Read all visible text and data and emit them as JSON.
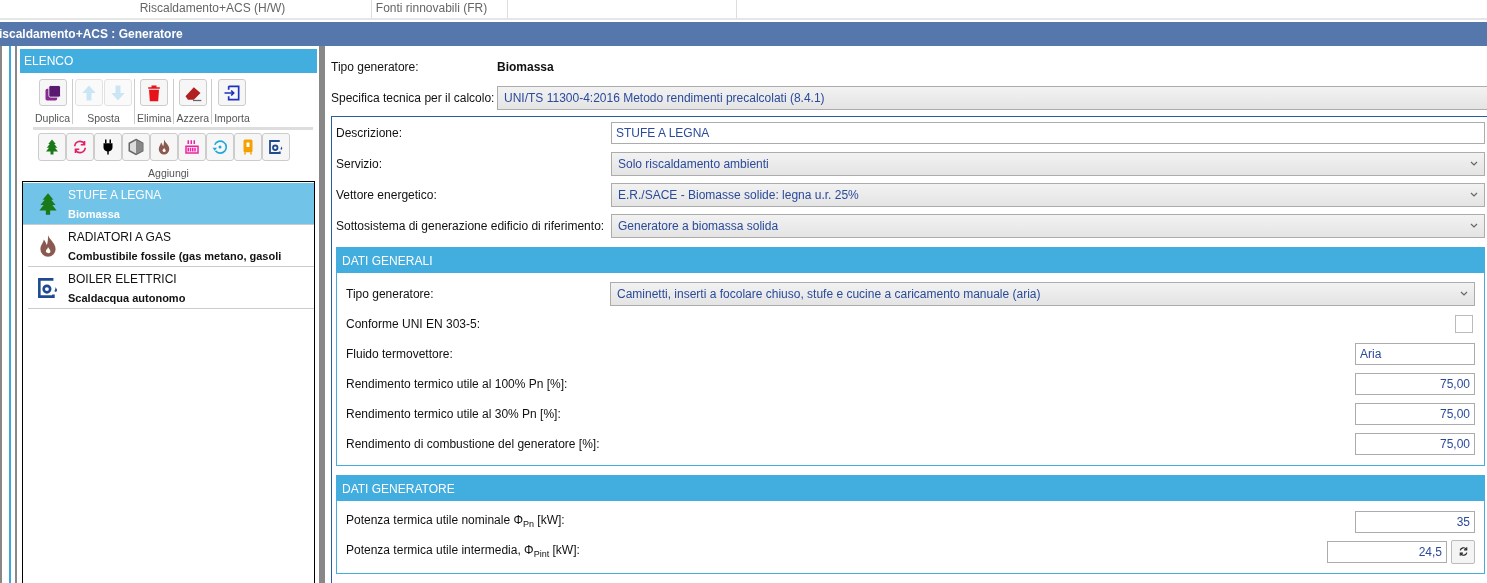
{
  "top_tabs": [
    {
      "label": "Riscaldamento+ACS (H/W)"
    },
    {
      "label": "Fonti rinnovabili (FR)"
    }
  ],
  "title_bar": "iscaldamento+ACS : Generatore",
  "elenco": {
    "title": "ELENCO",
    "toolbar_groups": [
      {
        "label": "Duplica",
        "buttons": [
          {
            "kind": "duplicate",
            "disabled": false
          }
        ]
      },
      {
        "label": "Sposta",
        "buttons": [
          {
            "kind": "up",
            "disabled": true
          },
          {
            "kind": "down",
            "disabled": true
          }
        ]
      },
      {
        "label": "Elimina",
        "buttons": [
          {
            "kind": "trash",
            "disabled": false
          }
        ]
      },
      {
        "label": "Azzera",
        "buttons": [
          {
            "kind": "eraser",
            "disabled": false
          }
        ]
      },
      {
        "label": "Importa",
        "buttons": [
          {
            "kind": "import",
            "disabled": false
          }
        ]
      }
    ],
    "add_buttons": [
      {
        "kind": "tree"
      },
      {
        "kind": "cycle"
      },
      {
        "kind": "plug"
      },
      {
        "kind": "hexagon"
      },
      {
        "kind": "flame"
      },
      {
        "kind": "radiator"
      },
      {
        "kind": "rotate"
      },
      {
        "kind": "boiler"
      },
      {
        "kind": "heater"
      }
    ],
    "add_label": "Aggiungi",
    "items": [
      {
        "kind": "tree",
        "title": "STUFE A LEGNA",
        "subtitle": "Biomassa",
        "selected": true
      },
      {
        "kind": "flame",
        "title": "RADIATORI A GAS",
        "subtitle": "Combustibile fossile (gas metano, gasoli",
        "selected": false
      },
      {
        "kind": "heater",
        "title": "BOILER ELETTRICI",
        "subtitle": "Scaldacqua autonomo",
        "selected": false
      }
    ]
  },
  "header_fields": [
    {
      "kind": "static",
      "label": "Tipo generatore:",
      "value": "Biomassa"
    },
    {
      "kind": "readonly",
      "label": "Specifica tecnica per il calcolo:",
      "value": "UNI/TS 11300-4:2016 Metodo rendimenti precalcolati (8.4.1)"
    }
  ],
  "main_fields": [
    {
      "kind": "text",
      "label": "Descrizione:",
      "value": "STUFE A LEGNA"
    },
    {
      "kind": "select",
      "label": "Servizio:",
      "value": "Solo riscaldamento ambienti"
    },
    {
      "kind": "select",
      "label": "Vettore energetico:",
      "value": "E.R./SACE - Biomasse solide: legna u.r. 25%"
    },
    {
      "kind": "select",
      "label": "Sottosistema di generazione edificio di riferimento:",
      "value": "Generatore a biomassa solida"
    }
  ],
  "sections": [
    {
      "title": "DATI GENERALI",
      "fields": [
        {
          "kind": "select",
          "label": "Tipo generatore:",
          "value": "Caminetti, inserti a focolare chiuso, stufe e cucine a caricamento manuale (aria)"
        },
        {
          "kind": "checkbox",
          "label": "Conforme UNI EN 303-5:",
          "checked": false
        },
        {
          "kind": "short",
          "label": "Fluido termovettore:",
          "value": "Aria"
        },
        {
          "kind": "number",
          "label": "Rendimento termico utile al 100% Pn [%]:",
          "value": "75,00"
        },
        {
          "kind": "number",
          "label": "Rendimento termico utile al 30% Pn [%]:",
          "value": "75,00"
        },
        {
          "kind": "number",
          "label": "Rendimento di combustione del generatore [%]:",
          "value": "75,00"
        }
      ]
    },
    {
      "title": "DATI GENERATORE",
      "fields": [
        {
          "kind": "number",
          "label": "Potenza termica utile nominale Φ$_{Pn}$ [kW]:",
          "value": "35"
        },
        {
          "kind": "number_refresh",
          "label": "Potenza termica utile intermedia, Φ$_{Pint}$ [kW]:",
          "value": "24,5"
        }
      ]
    }
  ]
}
